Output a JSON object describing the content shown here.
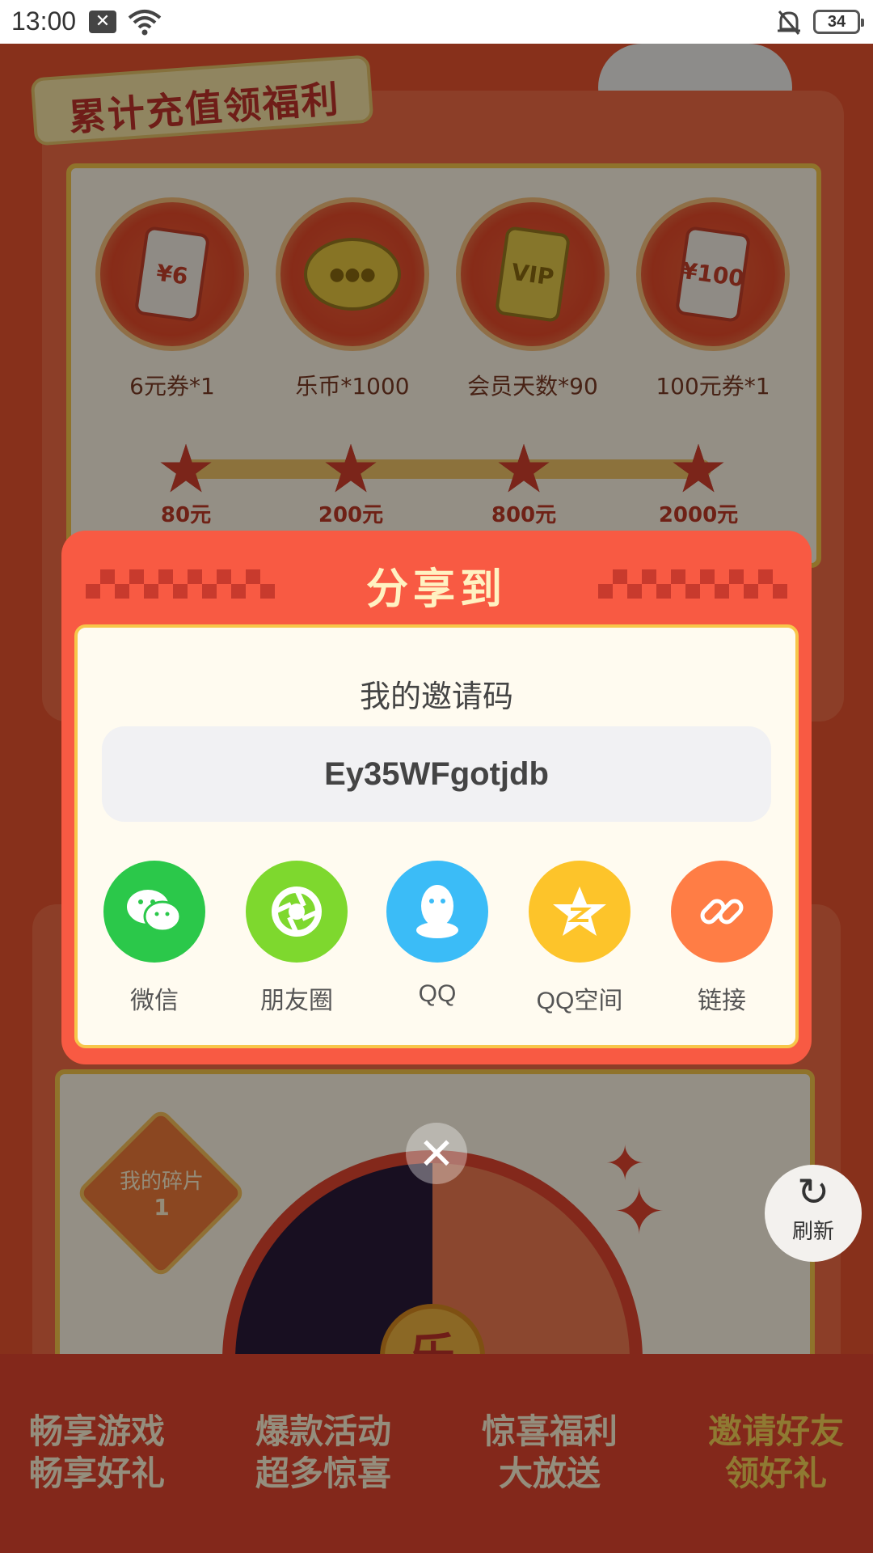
{
  "status_bar": {
    "time": "13:00",
    "battery": "34"
  },
  "background": {
    "banner_title": "累计充值领福利",
    "rewards": [
      {
        "label": "6元券*1",
        "icon_text": "¥6"
      },
      {
        "label": "乐币*1000",
        "icon_text": ""
      },
      {
        "label": "会员天数*90",
        "icon_text": "VIP"
      },
      {
        "label": "100元券*1",
        "icon_text": "¥100"
      }
    ],
    "milestones": [
      "80元",
      "200元",
      "800元",
      "2000元"
    ],
    "piece_label": "我的碎片",
    "piece_count": "1",
    "wheel_center": "乐",
    "features": [
      "畅享游戏\n畅享好礼",
      "爆款活动\n超多惊喜",
      "惊喜福利\n大放送",
      "邀请好友\n领好礼"
    ],
    "refresh_label": "刷新"
  },
  "dialog": {
    "title": "分享到",
    "invite_label": "我的邀请码",
    "invite_code": "Ey35WFgotjdb",
    "options": [
      {
        "label": "微信",
        "icon": "wechat-icon",
        "color": "#2bc84a"
      },
      {
        "label": "朋友圈",
        "icon": "moments-icon",
        "color": "#7ed82e"
      },
      {
        "label": "QQ",
        "icon": "qq-icon",
        "color": "#3bbcf7"
      },
      {
        "label": "QQ空间",
        "icon": "qzone-icon",
        "color": "#fdc42a"
      },
      {
        "label": "链接",
        "icon": "link-icon",
        "color": "#ff7d45"
      }
    ]
  },
  "colors": {
    "dialog_red": "#f85a43",
    "accent_gold": "#f7c64a"
  }
}
